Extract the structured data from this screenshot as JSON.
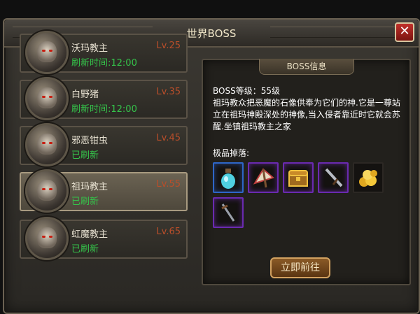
{
  "window": {
    "title": "世界BOSS",
    "close_icon": "close-icon"
  },
  "bosses": [
    {
      "name": "沃玛教主",
      "level": "Lv.25",
      "status": "刷新时间:12:00",
      "selected": false
    },
    {
      "name": "白野猪",
      "level": "Lv.35",
      "status": "刷新时间:12:00",
      "selected": false
    },
    {
      "name": "邪恶钳虫",
      "level": "Lv.45",
      "status": "已刷新",
      "selected": false
    },
    {
      "name": "祖玛教主",
      "level": "Lv.55",
      "status": "已刷新",
      "selected": true
    },
    {
      "name": "虹魔教主",
      "level": "Lv.65",
      "status": "已刷新",
      "selected": false
    }
  ],
  "info": {
    "tab_label": "BOSS信息",
    "level_line": "BOSS等级：55级",
    "description": "祖玛教众把恶魔的石像供奉为它们的神.它是一尊站立在祖玛神殿深处的神像,当入侵者靠近时它就会苏醒.坐镇祖玛教主之家",
    "drops_label": "极品掉落:",
    "drops": [
      {
        "item": "potion-bottle-icon",
        "rarity": "blue"
      },
      {
        "item": "fan-icon",
        "rarity": "purple"
      },
      {
        "item": "treasure-chest-icon",
        "rarity": "purple"
      },
      {
        "item": "sword-icon",
        "rarity": "purple"
      },
      {
        "item": "gold-coins-icon",
        "rarity": "none"
      },
      {
        "item": "dagger-icon",
        "rarity": "purple"
      }
    ]
  },
  "go_button": "立即前往",
  "colors": {
    "level_red": "#b94e2a",
    "status_green": "#35c24a",
    "purple_border": "#6a2ab0",
    "blue_border": "#2e66c8"
  }
}
